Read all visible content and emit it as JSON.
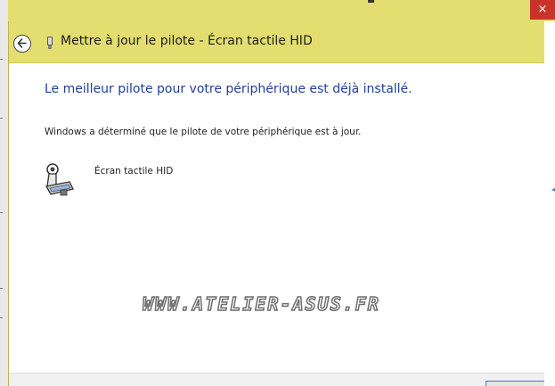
{
  "window": {
    "title": "Mettre à jour le pilote - Écran tactile HID",
    "close_glyph": "×"
  },
  "content": {
    "heading": "Le meilleur pilote pour votre périphérique est déjà installé.",
    "description": "Windows a déterminé que le pilote de votre périphérique est à jour.",
    "device_name": "Écran tactile HID"
  },
  "watermark": {
    "text": "WWW.ATELIER-ASUS.FR"
  },
  "icons": {
    "back": "back-arrow-icon",
    "title_device": "usb-device-icon",
    "device": "touchscreen-device-icon"
  },
  "colors": {
    "title_bar": "#e3de6f",
    "heading_blue": "#1f3f9a",
    "close_red": "#c9342a",
    "accent_blue": "#3c7fd1"
  }
}
